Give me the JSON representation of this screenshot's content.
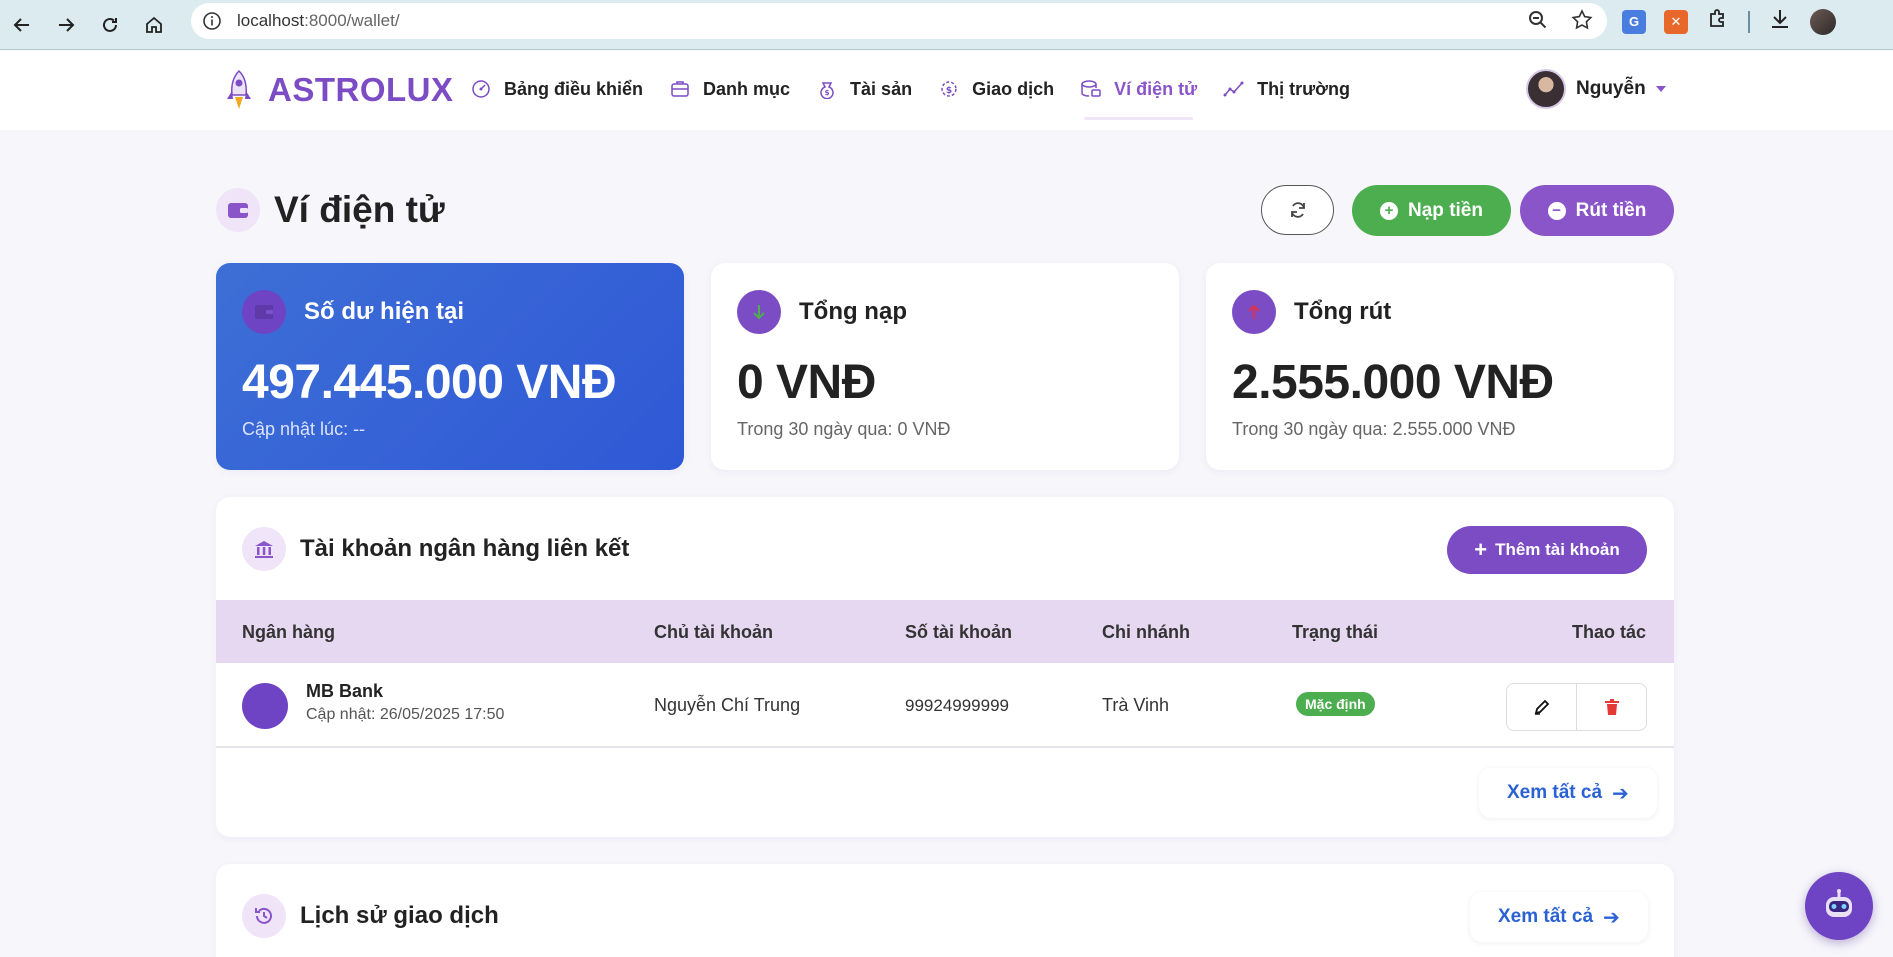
{
  "browser": {
    "url_host": "localhost",
    "url_rest": ":8000/wallet/"
  },
  "app": {
    "brand": "ASTROLUX",
    "nav": [
      {
        "label": "Bảng điều khiển",
        "icon": "dashboard-icon"
      },
      {
        "label": "Danh mục",
        "icon": "portfolio-icon"
      },
      {
        "label": "Tài sản",
        "icon": "assets-icon"
      },
      {
        "label": "Giao dịch",
        "icon": "transactions-icon"
      },
      {
        "label": "Ví điện tử",
        "icon": "wallet-icon",
        "active": true
      },
      {
        "label": "Thị trường",
        "icon": "market-icon"
      }
    ],
    "user_name": "Nguyễn"
  },
  "page": {
    "title": "Ví điện tử",
    "deposit_label": "Nạp tiền",
    "withdraw_label": "Rút tiền"
  },
  "stats": {
    "balance": {
      "label": "Số dư hiện tại",
      "value": "497.445.000 VNĐ",
      "sub": "Cập nhật lúc: --"
    },
    "deposits": {
      "label": "Tổng nạp",
      "value": "0 VNĐ",
      "sub": "Trong 30 ngày qua: 0 VNĐ"
    },
    "withdrawals": {
      "label": "Tổng rút",
      "value": "2.555.000 VNĐ",
      "sub": "Trong 30 ngày qua: 2.555.000 VNĐ"
    }
  },
  "banks": {
    "title": "Tài khoản ngân hàng liên kết",
    "add_label": "Thêm tài khoản",
    "columns": [
      "Ngân hàng",
      "Chủ tài khoản",
      "Số tài khoản",
      "Chi nhánh",
      "Trạng thái",
      "Thao tác"
    ],
    "rows": [
      {
        "bank": "MB Bank",
        "updated": "Cập nhật: 26/05/2025 17:50",
        "holder": "Nguyễn Chí Trung",
        "number": "99924999999",
        "branch": "Trà Vinh",
        "status": "Mặc định"
      }
    ],
    "view_all": "Xem tất cả"
  },
  "history": {
    "title": "Lịch sử giao dịch",
    "view_all": "Xem tất cả"
  },
  "colors": {
    "brand": "#7b4cc4",
    "primary_card": "#3d6fd6",
    "success": "#4cae4f",
    "link": "#2a62d4"
  }
}
